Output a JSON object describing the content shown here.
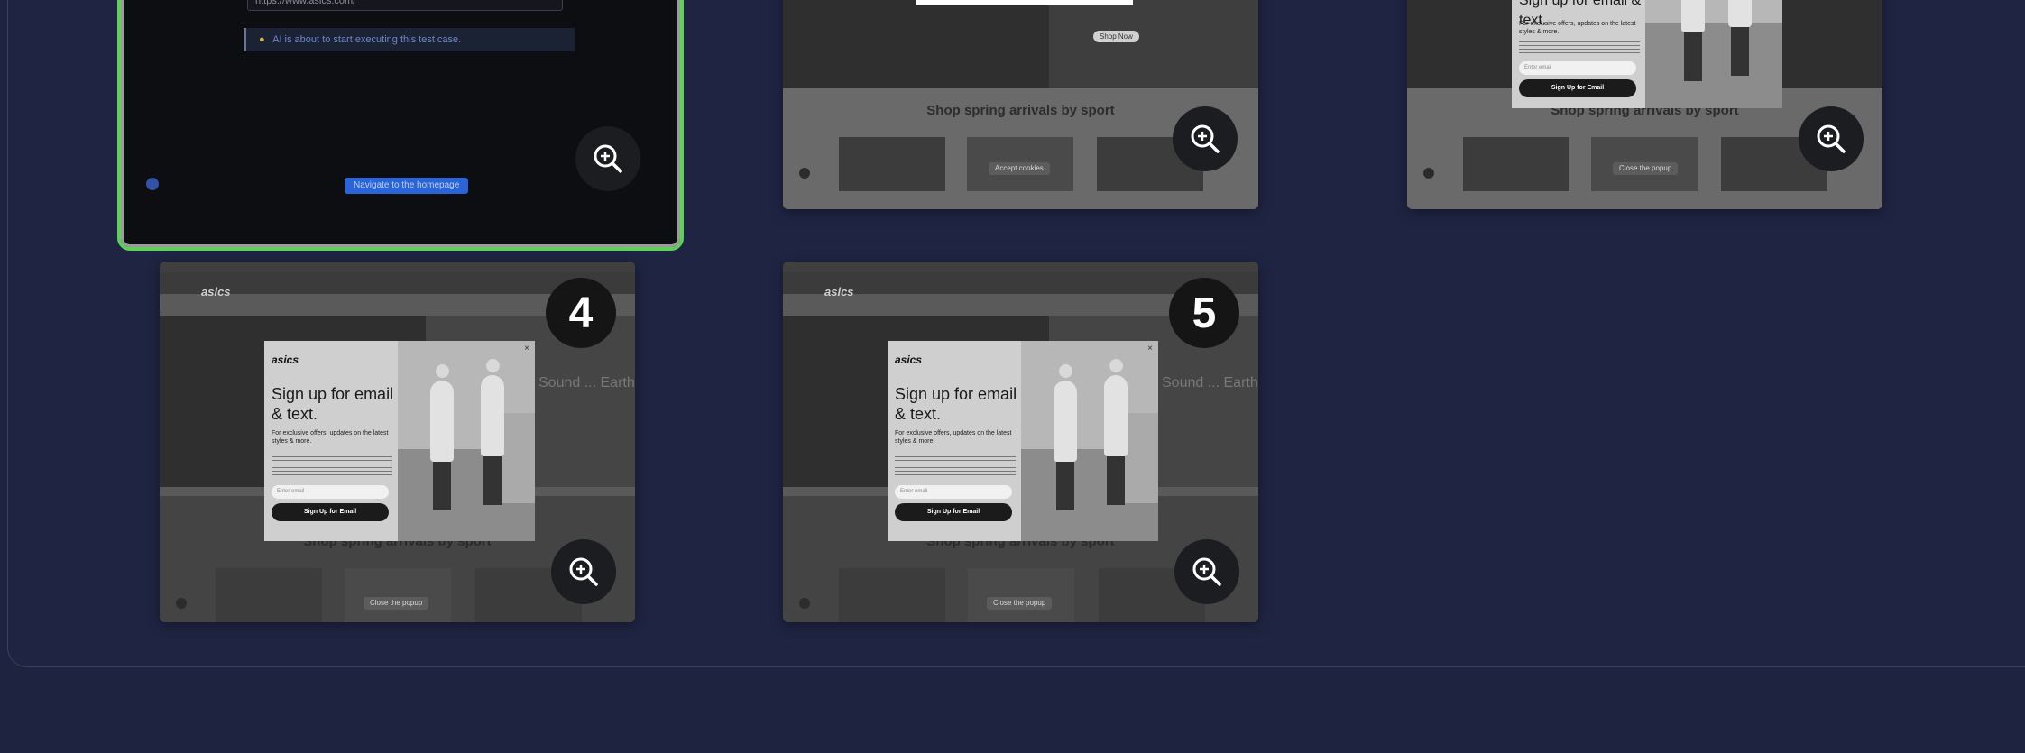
{
  "active_task": {
    "url": "https://www.asics.com/",
    "status": "AI is about to start executing this test case.",
    "nav_label": "Navigate to the homepage"
  },
  "cards": [
    {
      "id": "card-2",
      "badge": "",
      "popup": false,
      "pill": "Accept cookies"
    },
    {
      "id": "card-3",
      "badge": "",
      "popup": true,
      "pill": "Close the popup"
    },
    {
      "id": "card-4",
      "badge": "4",
      "popup": true,
      "pill": "Close the popup"
    },
    {
      "id": "card-5",
      "badge": "5",
      "popup": true,
      "pill": "Close the popup"
    }
  ],
  "site": {
    "logo": "asics",
    "shop_title": "Shop spring arrivals by sport",
    "shop_now": "Shop Now",
    "hero_text": "Sound ... Earth"
  },
  "popup": {
    "logo": "asics",
    "title": "Sign up for email & text.",
    "subtitle": "For exclusive offers, updates on the latest styles & more.",
    "input_placeholder": "Enter email",
    "button": "Sign Up for Email",
    "close": "×"
  },
  "badges": {
    "four": "4",
    "five": "5"
  },
  "icons": {
    "zoom": "zoom-in-icon"
  }
}
